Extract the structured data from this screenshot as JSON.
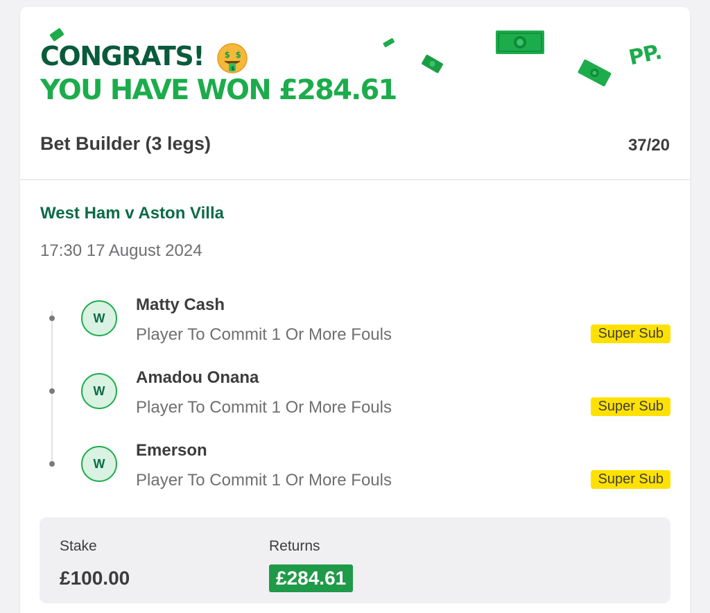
{
  "header": {
    "congrats_text": "CONGRATS!",
    "won_text": "YOU HAVE WON £284.61",
    "logo_text": "PP.",
    "emoji_icon": "money-mouth-face-icon"
  },
  "bet": {
    "title": "Bet Builder (3 legs)",
    "odds": "37/20"
  },
  "match": {
    "name": "West Ham v Aston Villa",
    "datetime": "17:30 17 August 2024"
  },
  "legs": [
    {
      "result": "W",
      "player": "Matty Cash",
      "market": "Player To Commit 1 Or More Fouls",
      "tag": "Super Sub"
    },
    {
      "result": "W",
      "player": "Amadou Onana",
      "market": "Player To Commit 1 Or More Fouls",
      "tag": "Super Sub"
    },
    {
      "result": "W",
      "player": "Emerson",
      "market": "Player To Commit 1 Or More Fouls",
      "tag": "Super Sub"
    }
  ],
  "summary": {
    "stake_label": "Stake",
    "stake_value": "£100.00",
    "returns_label": "Returns",
    "returns_value": "£284.61"
  },
  "colors": {
    "brand_dark_green": "#0a5a3c",
    "brand_green": "#1cac4b",
    "super_sub_yellow": "#ffe100",
    "returns_green": "#1f9a48"
  }
}
